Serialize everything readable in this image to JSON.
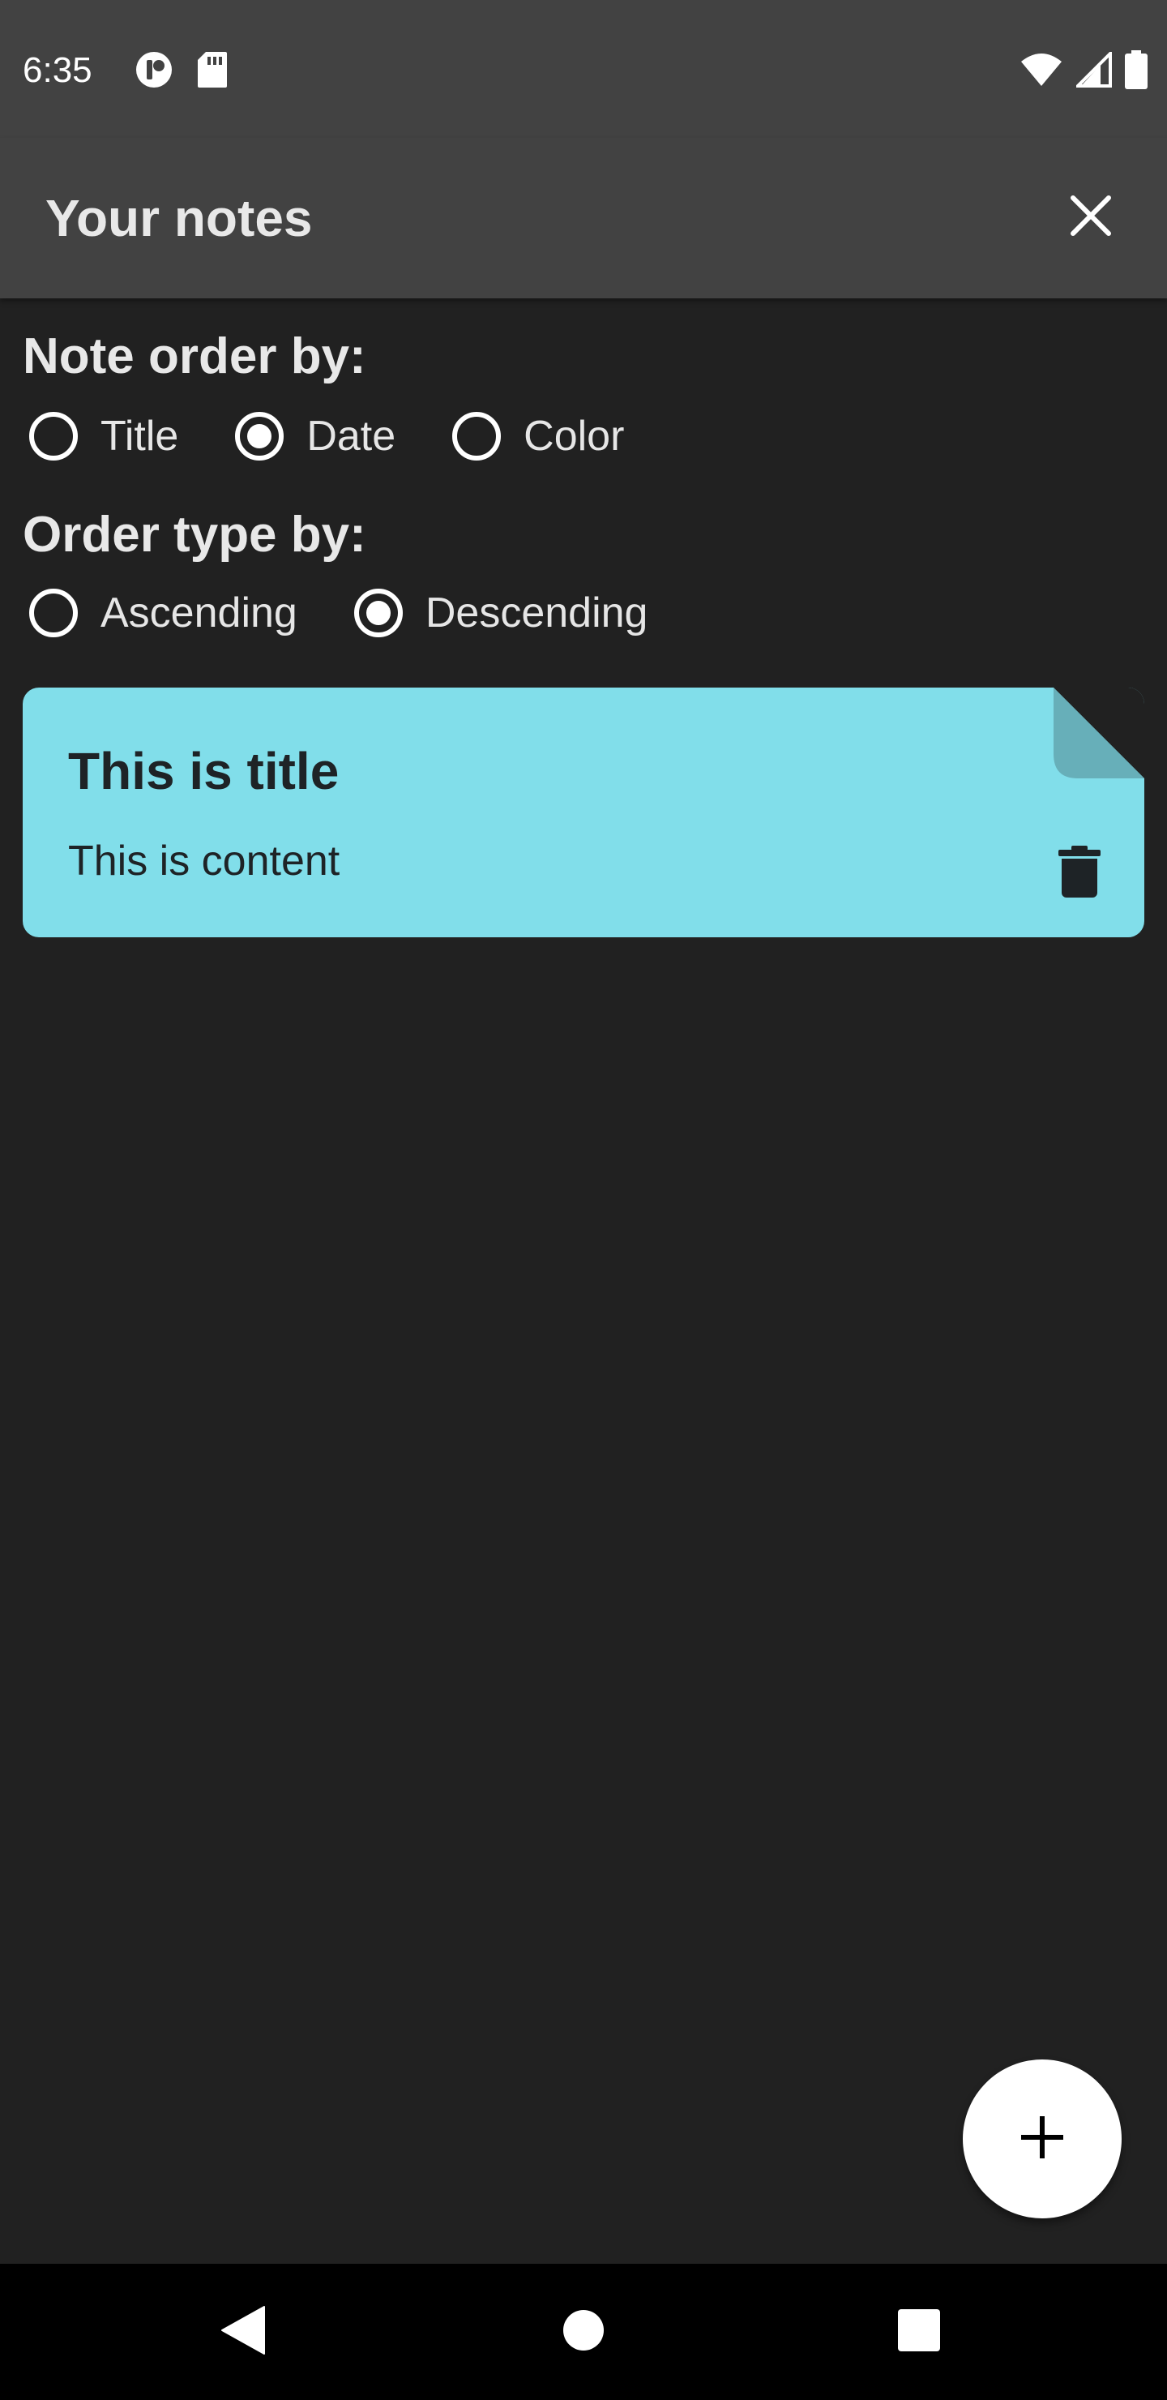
{
  "status_bar": {
    "time": "6:35",
    "icons": [
      "app-notification-icon",
      "sd-card-icon",
      "wifi-icon",
      "signal-icon",
      "battery-icon"
    ]
  },
  "app_bar": {
    "title": "Your notes",
    "close_icon": "close-icon"
  },
  "sort": {
    "order_by_label": "Note order by:",
    "order_by_options": [
      {
        "label": "Title",
        "selected": false
      },
      {
        "label": "Date",
        "selected": true
      },
      {
        "label": "Color",
        "selected": false
      }
    ],
    "order_type_label": "Order type by:",
    "order_type_options": [
      {
        "label": "Ascending",
        "selected": false
      },
      {
        "label": "Descending",
        "selected": true
      }
    ]
  },
  "notes": [
    {
      "title": "This is title",
      "content": "This is content",
      "color": "#81DEEA",
      "delete_icon": "trash-icon"
    }
  ],
  "fab": {
    "icon": "plus-icon"
  },
  "nav_bar": {
    "icons": [
      "back-icon",
      "home-icon",
      "recents-icon"
    ]
  },
  "colors": {
    "background": "#212121",
    "app_bar": "#424242",
    "note_cyan": "#81DEEA",
    "fab": "#FFFFFF"
  }
}
